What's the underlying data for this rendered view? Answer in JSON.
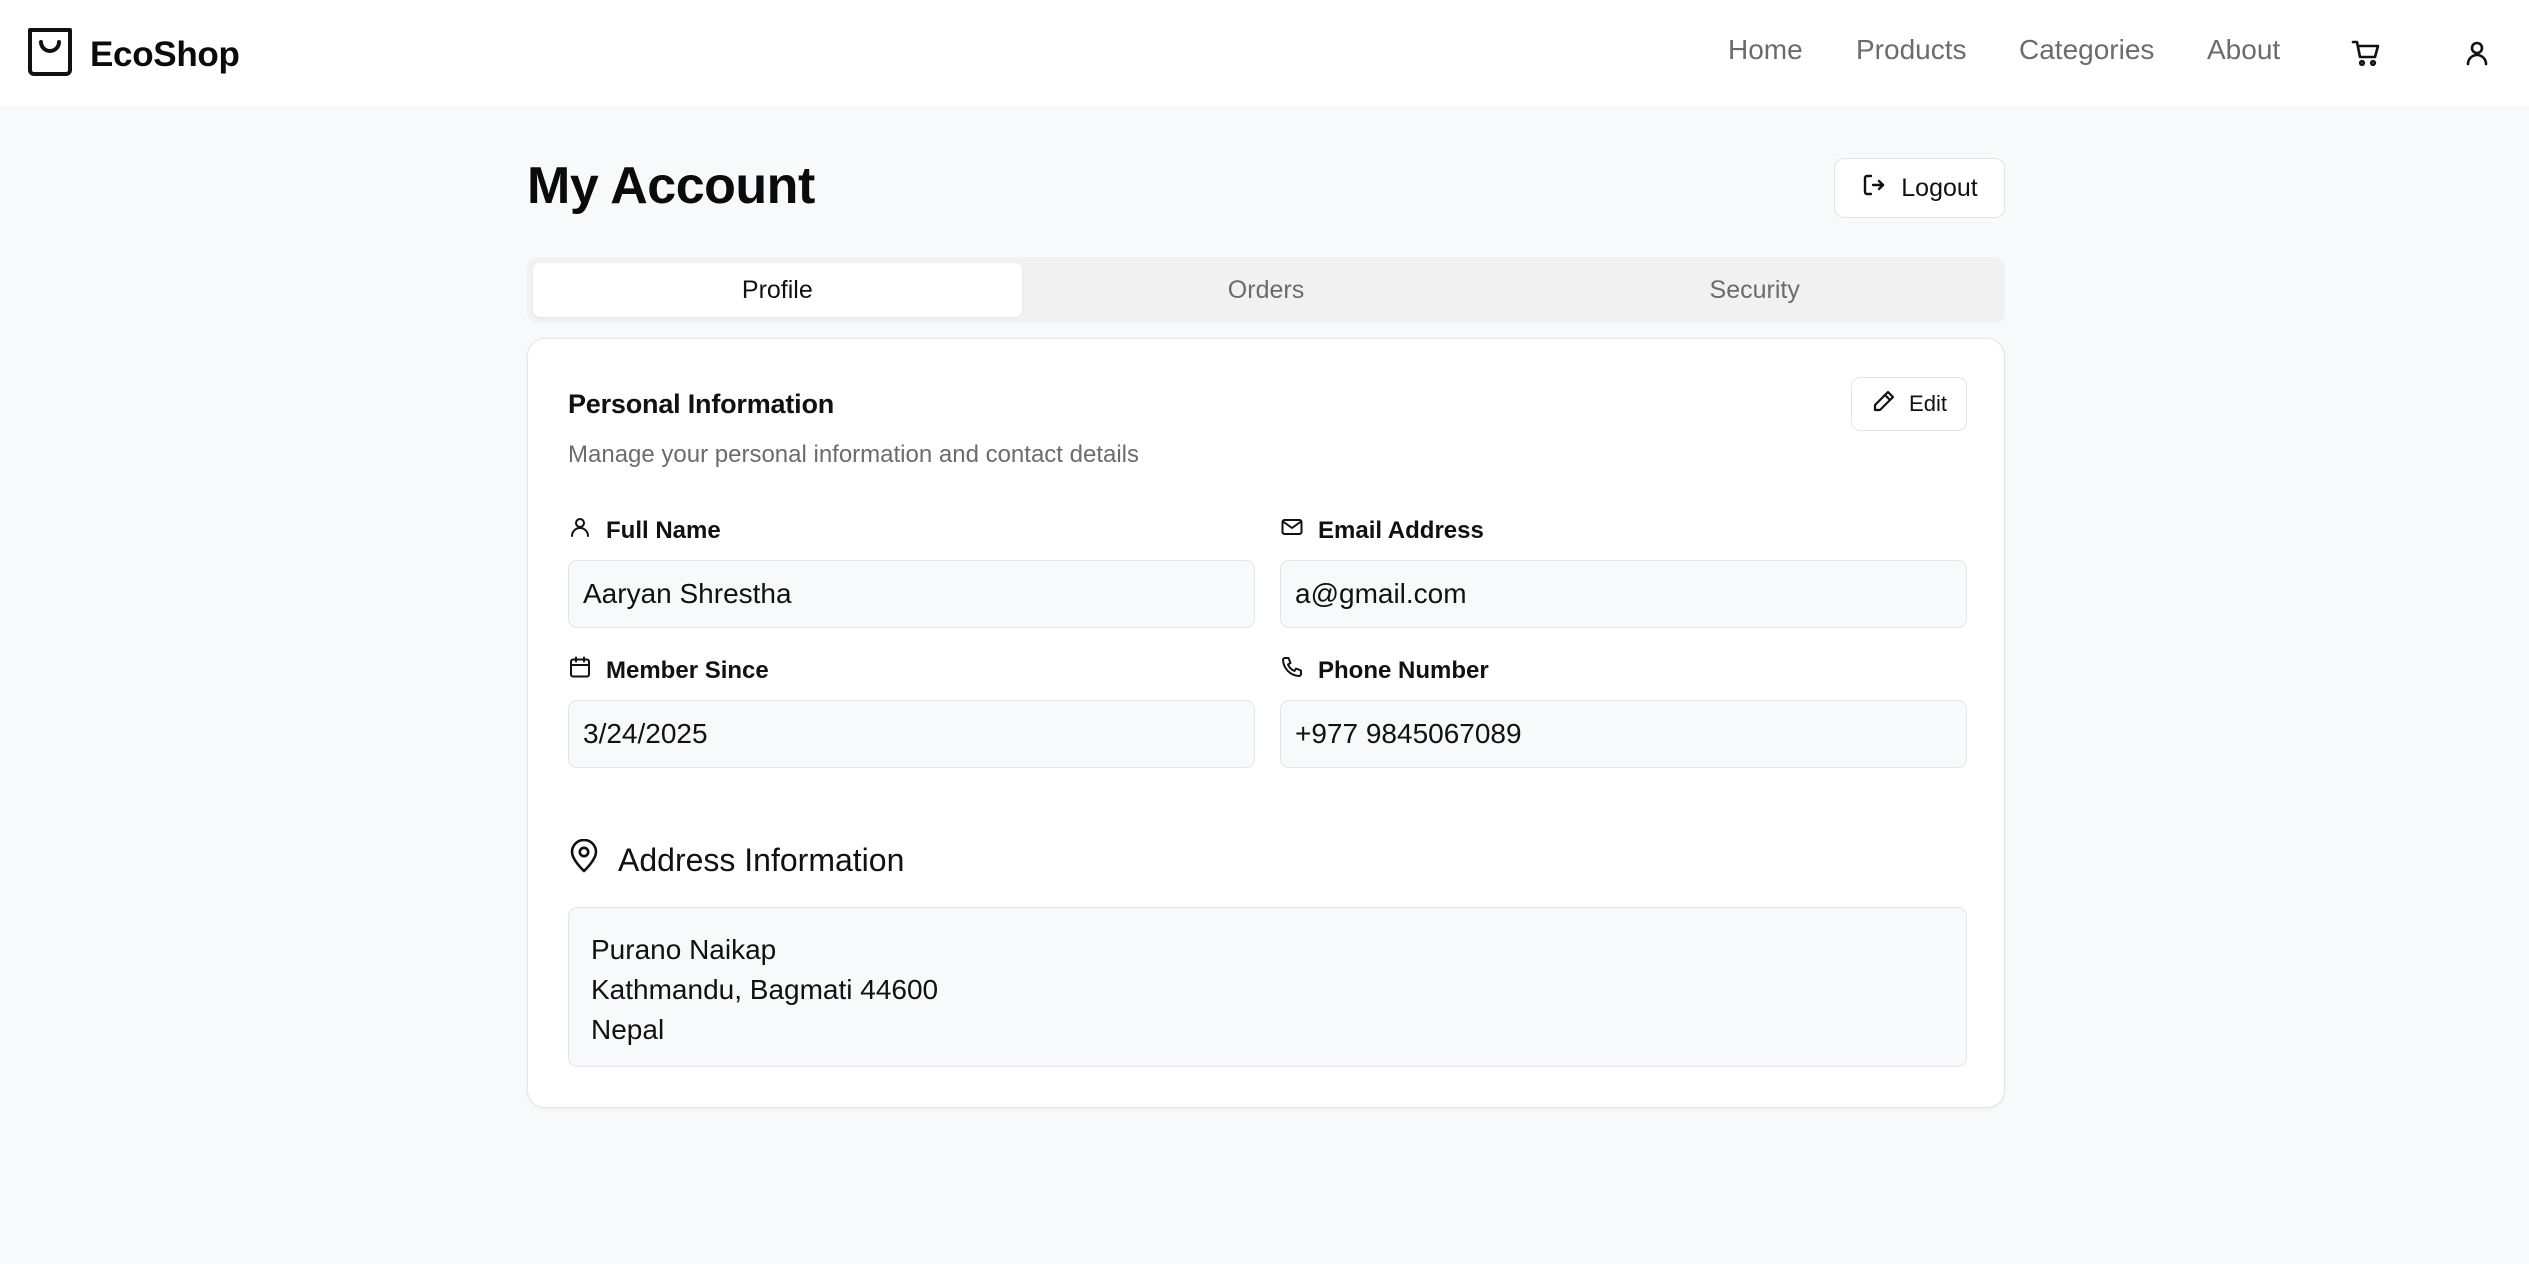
{
  "app": {
    "brand_name": "EcoShop"
  },
  "nav": {
    "links": [
      "Home",
      "Products",
      "Categories",
      "About"
    ],
    "icons": [
      "cart-icon",
      "user-icon"
    ]
  },
  "page": {
    "title": "My Account",
    "logout_label": "Logout"
  },
  "tabs": [
    {
      "label": "Profile",
      "active": true
    },
    {
      "label": "Orders",
      "active": false
    },
    {
      "label": "Security",
      "active": false
    }
  ],
  "personal": {
    "title": "Personal Information",
    "subtitle": "Manage your personal information and contact details",
    "edit_label": "Edit",
    "fields": {
      "full_name": {
        "label": "Full Name",
        "value": "Aaryan Shrestha",
        "icon": "user-icon"
      },
      "email": {
        "label": "Email Address",
        "value": "a@gmail.com",
        "icon": "mail-icon"
      },
      "member_since": {
        "label": "Member Since",
        "value": "3/24/2025",
        "icon": "calendar-icon"
      },
      "phone": {
        "label": "Phone Number",
        "value": "+977 9845067089",
        "icon": "phone-icon"
      }
    }
  },
  "address": {
    "title": "Address Information",
    "lines": [
      "Purano Naikap",
      "Kathmandu, Bagmati 44600",
      "Nepal"
    ]
  }
}
